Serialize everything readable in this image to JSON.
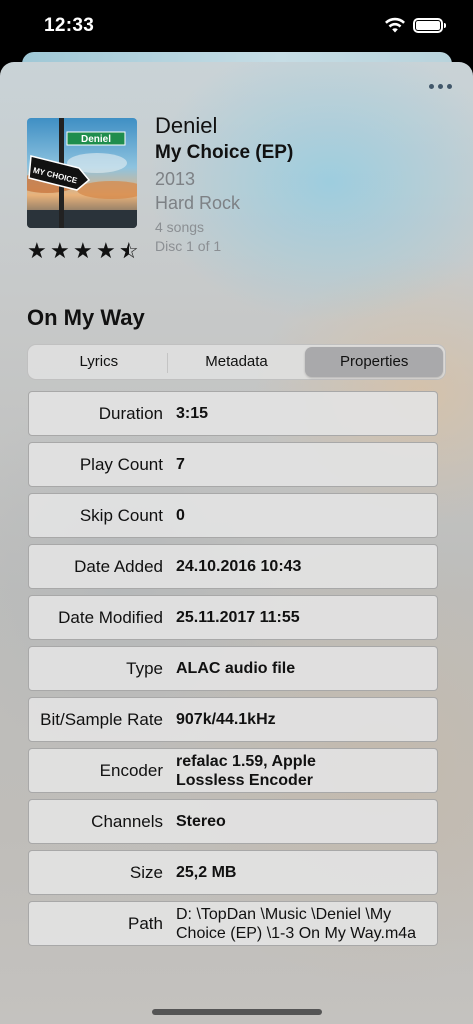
{
  "status_bar": {
    "time": "12:33"
  },
  "track": {
    "artist": "Deniel",
    "album": "My Choice (EP)",
    "year": "2013",
    "genre": "Hard Rock",
    "songs": "4 songs",
    "disc": "Disc 1 of 1",
    "rating": 4.5,
    "title": "On My Way",
    "art": {
      "sign_top": "Deniel",
      "sign_arrow": "MY CHOICE"
    }
  },
  "tabs": [
    {
      "label": "Lyrics",
      "selected": false
    },
    {
      "label": "Metadata",
      "selected": false
    },
    {
      "label": "Properties",
      "selected": true
    }
  ],
  "properties": [
    {
      "label": "Duration",
      "value": "3:15"
    },
    {
      "label": "Play Count",
      "value": "7"
    },
    {
      "label": "Skip Count",
      "value": "0"
    },
    {
      "label": "Date Added",
      "value": "24.10.2016 10:43"
    },
    {
      "label": "Date Modified",
      "value": "25.11.2017 11:55"
    },
    {
      "label": "Type",
      "value": "ALAC audio file"
    },
    {
      "label": "Bit/Sample Rate",
      "value": "907k/44.1kHz"
    },
    {
      "label": "Encoder",
      "value": "refalac 1.59, Apple Lossless Encoder"
    },
    {
      "label": "Channels",
      "value": "Stereo"
    },
    {
      "label": "Size",
      "value": "25,2 MB"
    },
    {
      "label": "Path",
      "value": "D: \\TopDan  \\Music  \\Deniel  \\My Choice (EP)  \\1-3 On My Way.m4a"
    }
  ],
  "colors": {
    "accent_dots": "#41576a",
    "selected_tab": "#a9a9ab"
  }
}
